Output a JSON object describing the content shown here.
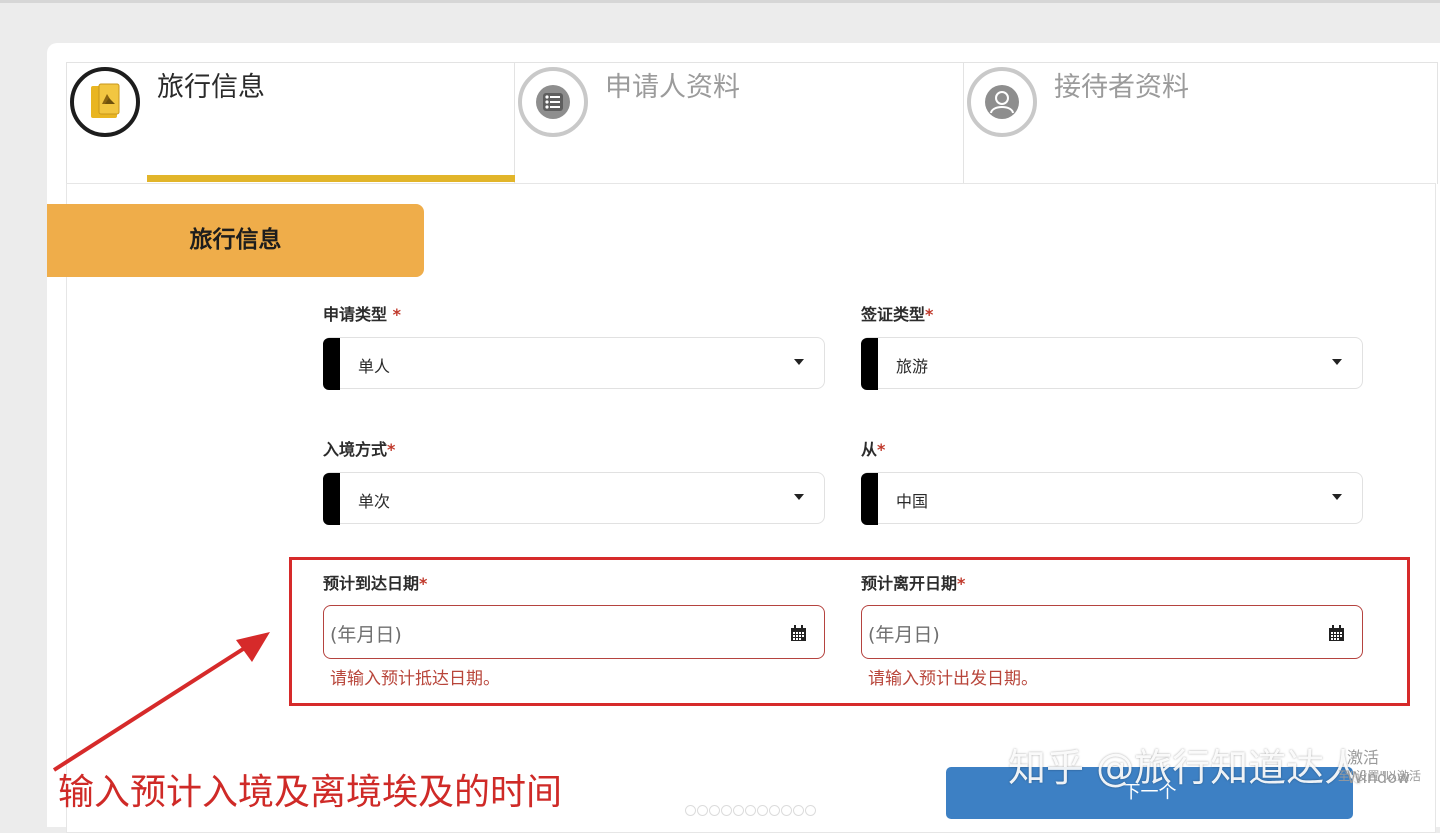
{
  "steps": [
    {
      "label": "旅行信息",
      "icon": "passport-icon",
      "active": true
    },
    {
      "label": "申请人资料",
      "icon": "list-icon",
      "active": false
    },
    {
      "label": "接待者资料",
      "icon": "user-icon",
      "active": false
    }
  ],
  "section": {
    "title": "旅行信息"
  },
  "fields": {
    "application_type": {
      "label": "申请类型",
      "required": "*",
      "value": "单人"
    },
    "visa_type": {
      "label": "签证类型",
      "required": "*",
      "value": "旅游"
    },
    "entry_mode": {
      "label": "入境方式",
      "required": "*",
      "value": "单次"
    },
    "from": {
      "label": "从",
      "required": "*",
      "value": "中国"
    },
    "arrival_date": {
      "label": "预计到达日期",
      "required": "*",
      "placeholder": "(年月日)",
      "error": "请输入预计抵达日期。"
    },
    "departure_date": {
      "label": "预计离开日期",
      "required": "*",
      "placeholder": "(年月日)",
      "error": "请输入预计出发日期。"
    }
  },
  "annotation": {
    "text": "输入预计入境及离境埃及的时间"
  },
  "next_button": {
    "label": "下一个"
  },
  "watermark": {
    "text": "知乎 @旅行知道达人"
  },
  "system_overlay": {
    "line1": "激活 Window",
    "line2": "至\"设置\"以激活"
  },
  "colors": {
    "accent": "#e2b52a",
    "section_tab": "#efad4a",
    "error": "#d62a2a",
    "button": "#3d80c4"
  }
}
